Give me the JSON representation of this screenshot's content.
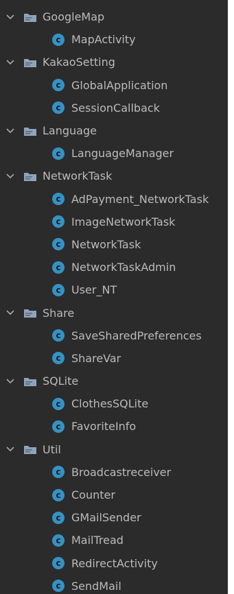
{
  "colors": {
    "panel_bg": "#2b2b2b",
    "text": "#bbbbbb",
    "class_icon": "#3592c4",
    "folder_icon": "#8fa4ba"
  },
  "icons": {
    "expand": "chevron-down-icon",
    "package": "folder-icon",
    "class": "class-icon"
  },
  "class_icon_letter": "c",
  "tree": [
    {
      "type": "folder",
      "label": "GoogleMap"
    },
    {
      "type": "class",
      "label": "MapActivity"
    },
    {
      "type": "folder",
      "label": "KakaoSetting"
    },
    {
      "type": "class",
      "label": "GlobalApplication"
    },
    {
      "type": "class",
      "label": "SessionCallback"
    },
    {
      "type": "folder",
      "label": "Language"
    },
    {
      "type": "class",
      "label": "LanguageManager"
    },
    {
      "type": "folder",
      "label": "NetworkTask"
    },
    {
      "type": "class",
      "label": "AdPayment_NetworkTask"
    },
    {
      "type": "class",
      "label": "ImageNetworkTask"
    },
    {
      "type": "class",
      "label": "NetworkTask"
    },
    {
      "type": "class",
      "label": "NetworkTaskAdmin"
    },
    {
      "type": "class",
      "label": "User_NT"
    },
    {
      "type": "folder",
      "label": "Share"
    },
    {
      "type": "class",
      "label": "SaveSharedPreferences"
    },
    {
      "type": "class",
      "label": "ShareVar"
    },
    {
      "type": "folder",
      "label": "SQLite"
    },
    {
      "type": "class",
      "label": "ClothesSQLite"
    },
    {
      "type": "class",
      "label": "FavoriteInfo"
    },
    {
      "type": "folder",
      "label": "Util"
    },
    {
      "type": "class",
      "label": "Broadcastreceiver"
    },
    {
      "type": "class",
      "label": "Counter"
    },
    {
      "type": "class",
      "label": "GMailSender"
    },
    {
      "type": "class",
      "label": "MailTread"
    },
    {
      "type": "class",
      "label": "RedirectActivity"
    },
    {
      "type": "class",
      "label": "SendMail"
    }
  ]
}
